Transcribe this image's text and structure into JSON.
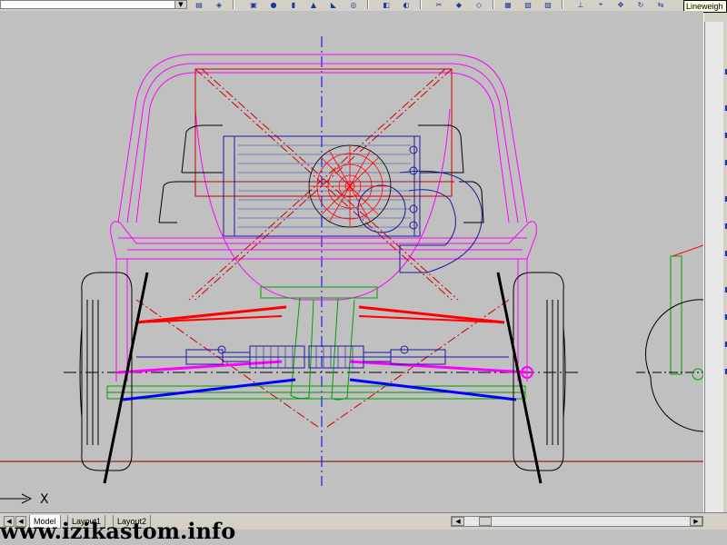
{
  "tooltip": {
    "text": "Lineweigh"
  },
  "ucs": {
    "axis_label": "X"
  },
  "layout_tabs": [
    {
      "label": "Model",
      "active": true
    },
    {
      "label": "Layout1",
      "active": false
    },
    {
      "label": "Layout2",
      "active": false
    }
  ],
  "watermark": {
    "text": "www.izikastom.info"
  },
  "colors": {
    "background": "#c0c0c0",
    "magenta": "#ff00ff",
    "red": "#ff0000",
    "blue": "#0000ff",
    "green": "#00a000",
    "dark_red": "#cc0000",
    "navy": "#1a1aa0",
    "black": "#000000"
  },
  "icons": [
    "layers-icon",
    "sphere-icon",
    "cylinder-icon",
    "cone-icon",
    "wedge-icon",
    "box-icon",
    "torus-icon",
    "extrude-icon",
    "revolve-icon",
    "slice-icon",
    "section-icon",
    "union-icon",
    "subtract-icon",
    "intersect-icon",
    "linewidth-icon"
  ]
}
